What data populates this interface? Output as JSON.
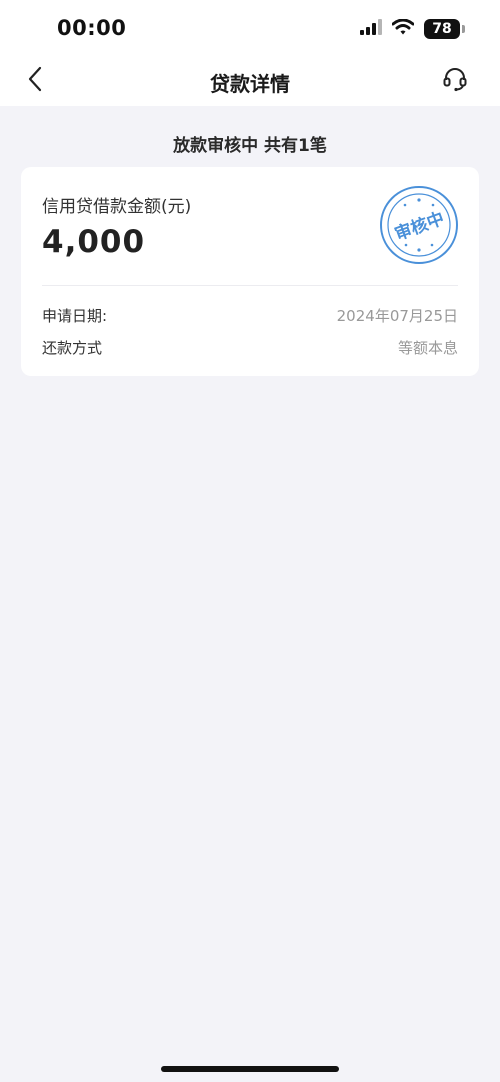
{
  "status_bar": {
    "time": "00:00",
    "battery": "78",
    "icons": [
      "signal-icon",
      "wifi-icon",
      "battery-icon"
    ]
  },
  "nav": {
    "title": "贷款详情",
    "back_icon": "chevron-left-icon",
    "support_icon": "headset-icon"
  },
  "section": {
    "header": "放款审核中 共有1笔"
  },
  "loan": {
    "amount_label": "信用贷借款金额(元)",
    "amount": "4,000",
    "stamp_text": "审核中",
    "details": [
      {
        "label": "申请日期:",
        "value": "2024年07月25日"
      },
      {
        "label": "还款方式",
        "value": "等额本息"
      }
    ]
  },
  "colors": {
    "stamp": "#4a90d9",
    "background": "#f3f3f8"
  }
}
